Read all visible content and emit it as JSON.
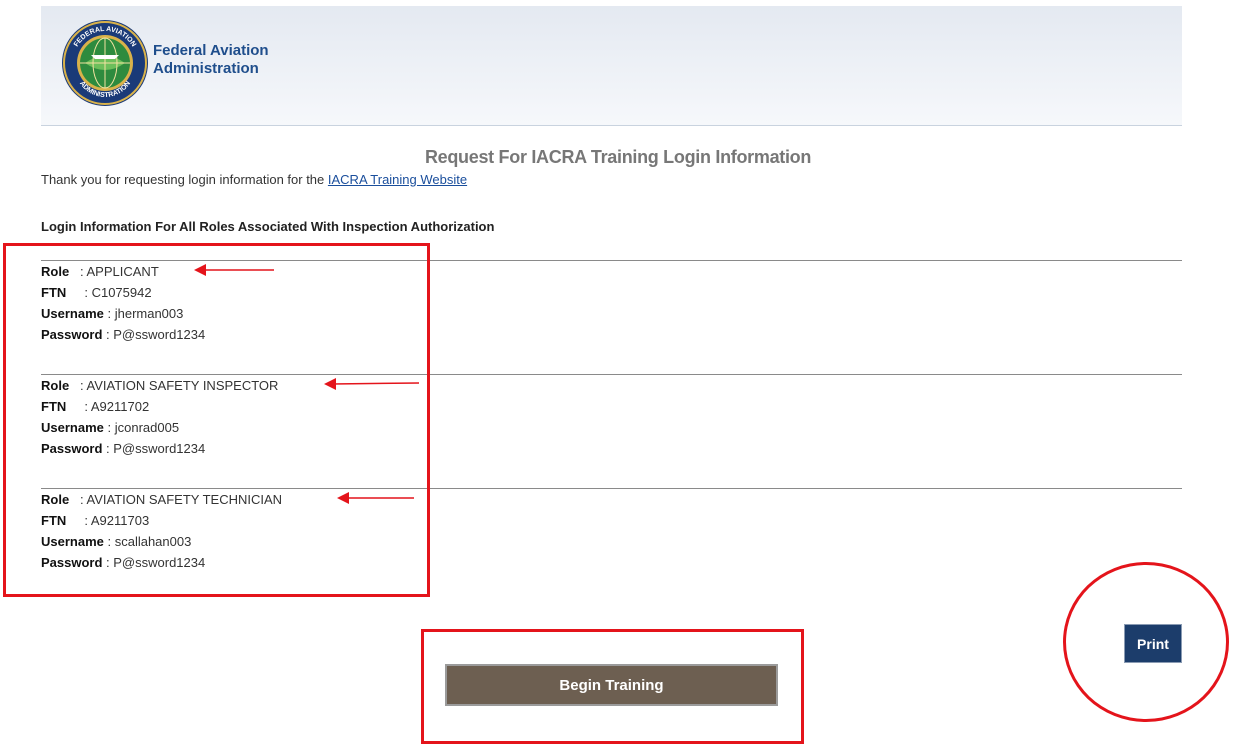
{
  "header": {
    "org_name": "Federal Aviation\nAdministration",
    "logo_icon": "faa-seal-icon",
    "seal_text_top": "FEDERAL AVIATION",
    "seal_text_bottom": "ADMINISTRATION"
  },
  "page": {
    "title": "Request For IACRA Training Login Information",
    "thanks_text": "Thank you for requesting login information for the ",
    "thanks_link": "IACRA Training Website",
    "section_heading": "Login Information For All Roles Associated With Inspection Authorization"
  },
  "labels": {
    "role": "Role",
    "role_sep": "   : ",
    "ftn": "FTN",
    "ftn_sep": "     : ",
    "username": "Username",
    "username_sep": " : ",
    "password": "Password",
    "password_sep": " : "
  },
  "accounts": [
    {
      "role": "APPLICANT",
      "ftn": "C1075942",
      "username": "jherman003",
      "password": "P@ssword1234"
    },
    {
      "role": "AVIATION SAFETY INSPECTOR",
      "ftn": "A9211702",
      "username": "jconrad005",
      "password": "P@ssword1234"
    },
    {
      "role": "AVIATION SAFETY TECHNICIAN",
      "ftn": "A9211703",
      "username": "scallahan003",
      "password": "P@ssword1234"
    }
  ],
  "buttons": {
    "begin_training": "Begin Training",
    "print": "Print"
  },
  "annotation_color": "#e4141b"
}
